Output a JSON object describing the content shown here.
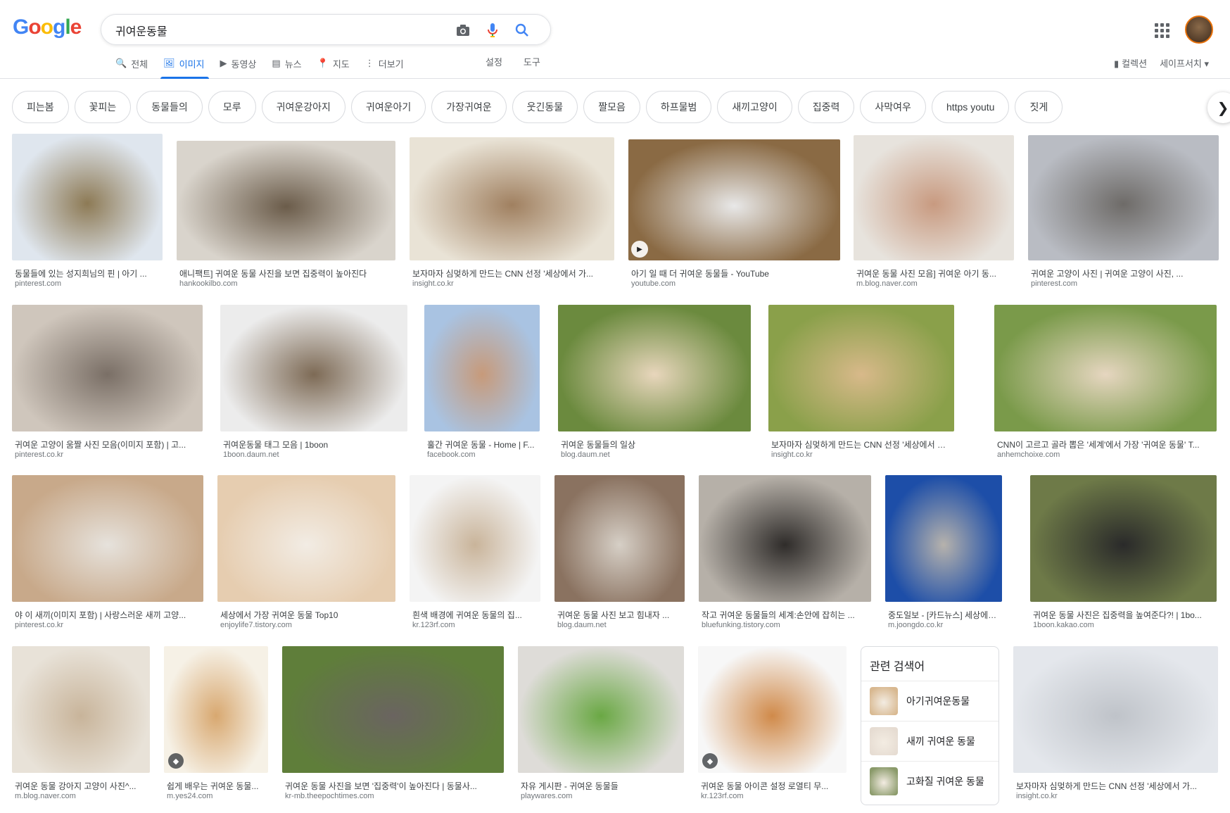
{
  "header": {
    "logo": [
      "G",
      "o",
      "o",
      "g",
      "l",
      "e"
    ],
    "logo_colors": [
      "#4285F4",
      "#EA4335",
      "#FBBC05",
      "#4285F4",
      "#34A853",
      "#EA4335"
    ],
    "query": "귀여운동물",
    "tabs": [
      {
        "icon": "🔍",
        "label": "전체"
      },
      {
        "icon": "🖼",
        "label": "이미지"
      },
      {
        "icon": "▶",
        "label": "동영상"
      },
      {
        "icon": "▤",
        "label": "뉴스"
      },
      {
        "icon": "📍",
        "label": "지도"
      },
      {
        "icon": "⋮",
        "label": "더보기"
      }
    ],
    "settings": "설정",
    "tools": "도구",
    "collections": "컬렉션",
    "safesearch": "세이프서치 ▾"
  },
  "chips": [
    "피는봄",
    "꽃피는",
    "동물들의",
    "모루",
    "귀여운강아지",
    "귀여운아기",
    "가장귀여운",
    "웃긴동물",
    "짤모음",
    "하프물범",
    "새끼고양이",
    "집중력",
    "사막여우",
    "https youtu",
    "짓게"
  ],
  "results": [
    {
      "title": "동물들에 있는 성지희님의 핀 | 아기 ...",
      "source": "pinterest.com",
      "colors": [
        "#dfe6ee",
        "#8d7a55"
      ]
    },
    {
      "title": "애니팩트] 귀여운 동물 사진을 보면 집중력이 높아진다",
      "source": "hankookilbo.com",
      "colors": [
        "#d9d4cc",
        "#6b5c4a"
      ]
    },
    {
      "title": "보자마자 심멎하게 만드는 CNN 선정 '세상에서 가...",
      "source": "insight.co.kr",
      "colors": [
        "#e9e3d6",
        "#a08060"
      ]
    },
    {
      "title": "아기 일 때 더 귀여운 동물들 - YouTube",
      "source": "youtube.com",
      "colors": [
        "#8a6a44",
        "#e8e8e8"
      ]
    },
    {
      "title": "귀여운 동물 사진 모음] 귀여운 아기 동...",
      "source": "m.blog.naver.com",
      "colors": [
        "#e7e3dd",
        "#c89a80"
      ]
    },
    {
      "title": "귀여운 고양이 사진 | 귀여운 고양이 사진, ...",
      "source": "pinterest.com",
      "colors": [
        "#b9bcc3",
        "#6e6b68"
      ]
    },
    {
      "title": "귀여운 고양이 움짤 사진 모음(이미지 포함) | 고...",
      "source": "pinterest.co.kr",
      "colors": [
        "#cfc6bc",
        "#7a6f66"
      ]
    },
    {
      "title": "귀여운동물 태그 모음 | 1boon",
      "source": "1boon.daum.net",
      "colors": [
        "#ececec",
        "#7d6a55"
      ]
    },
    {
      "title": "훌간 귀여운 동물 - Home | F...",
      "source": "facebook.com",
      "colors": [
        "#a9c3e2",
        "#c79a7a"
      ]
    },
    {
      "title": "귀여운 동물들의 일상",
      "source": "blog.daum.net",
      "colors": [
        "#6b8a3e",
        "#e8d6bc"
      ]
    },
    {
      "title": "보자마자 심멎하게 만드는 CNN 선정 '세상에서 가장 ...",
      "source": "insight.co.kr",
      "colors": [
        "#8aa04a",
        "#d8b98a"
      ]
    },
    {
      "title": "CNN이 고르고 골라 뽑은 '세계'에서 가장 '귀여운 동물' T...",
      "source": "anhemchoixe.com",
      "colors": [
        "#7a9a4a",
        "#e6d6c0"
      ]
    },
    {
      "title": "야 이 새끼(이미지 포함) | 사랑스러운 새끼 고양...",
      "source": "pinterest.co.kr",
      "colors": [
        "#c8a98a",
        "#e6e2dc"
      ]
    },
    {
      "title": "세상에서 가장 귀여운 동물 Top10",
      "source": "enjoylife7.tistory.com",
      "colors": [
        "#e6cdb0",
        "#f2ece4"
      ]
    },
    {
      "title": "흰색 배경에 귀여운 동물의 집...",
      "source": "kr.123rf.com",
      "colors": [
        "#f4f4f4",
        "#c9b49a"
      ]
    },
    {
      "title": "귀여운 동물 사진 보고 힘내자 ...",
      "source": "blog.daum.net",
      "colors": [
        "#8a7260",
        "#d6cfc6"
      ]
    },
    {
      "title": "작고 귀여운 동물들의 세계:손안에 잡히는 ...",
      "source": "bluefunking.tistory.com",
      "colors": [
        "#b6b0a8",
        "#2f2c2a"
      ]
    },
    {
      "title": "중도일보 - [카드뉴스] 세상에서 ...",
      "source": "m.joongdo.co.kr",
      "colors": [
        "#1d4ea8",
        "#b6b2ac"
      ]
    },
    {
      "title": "귀여운 동물 사진은 집중력을 높여준다?! | 1bo...",
      "source": "1boon.kakao.com",
      "colors": [
        "#6e7a48",
        "#2a2a2a"
      ]
    },
    {
      "title": "귀여운 동물 강아지 고양이 사진^...",
      "source": "m.blog.naver.com",
      "colors": [
        "#e8e2d8",
        "#c8b49a"
      ]
    },
    {
      "title": "쉽게 배우는 귀여운 동물...",
      "source": "m.yes24.com",
      "colors": [
        "#f6f1e6",
        "#d8a870"
      ]
    },
    {
      "title": "귀여운 동물 사진을 보면 '집중력'이 높아진다 | 동물사...",
      "source": "kr-mb.theepochtimes.com",
      "colors": [
        "#5f7e3a",
        "#6a6460"
      ]
    },
    {
      "title": "자유 게시판 - 귀여운 동물들",
      "source": "playwares.com",
      "colors": [
        "#dedcd8",
        "#6aa844"
      ]
    },
    {
      "title": "귀여운 동물 아이콘 설정 로열티 무...",
      "source": "kr.123rf.com",
      "colors": [
        "#f7f7f7",
        "#d08a4a"
      ]
    },
    {
      "title": "보자마자 심멎하게 만드는 CNN 선정 '세상에서 가...",
      "source": "insight.co.kr",
      "colors": [
        "#e4e7ec",
        "#bfc3c9"
      ]
    }
  ],
  "related": {
    "title": "관련 검색어",
    "items": [
      {
        "label": "아기귀여운동물",
        "color": "#d8b890"
      },
      {
        "label": "새끼 귀여운 동물",
        "color": "#e6dcd2"
      },
      {
        "label": "고화질 귀여운 동물",
        "color": "#8a9a6a"
      }
    ]
  }
}
